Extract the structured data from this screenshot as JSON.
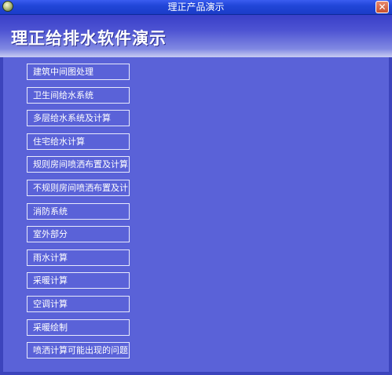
{
  "window": {
    "title": "理正产品演示",
    "close_label": "✕"
  },
  "banner": {
    "title": "理正给排水软件演示"
  },
  "menu": {
    "items": [
      "建筑中间图处理",
      "卫生间给水系统",
      "多层给水系统及计算",
      "住宅给水计算",
      "规则房间喷洒布置及计算",
      "不规则房间喷洒布置及计",
      "消防系统",
      "室外部分",
      "雨水计算",
      "采暖计算",
      "空调计算",
      "采暖绘制",
      "喷洒计算可能出现的问题"
    ]
  },
  "colors": {
    "background": "#5a62d8",
    "titlebar": "#2146d8",
    "close_button": "#d8603c"
  }
}
